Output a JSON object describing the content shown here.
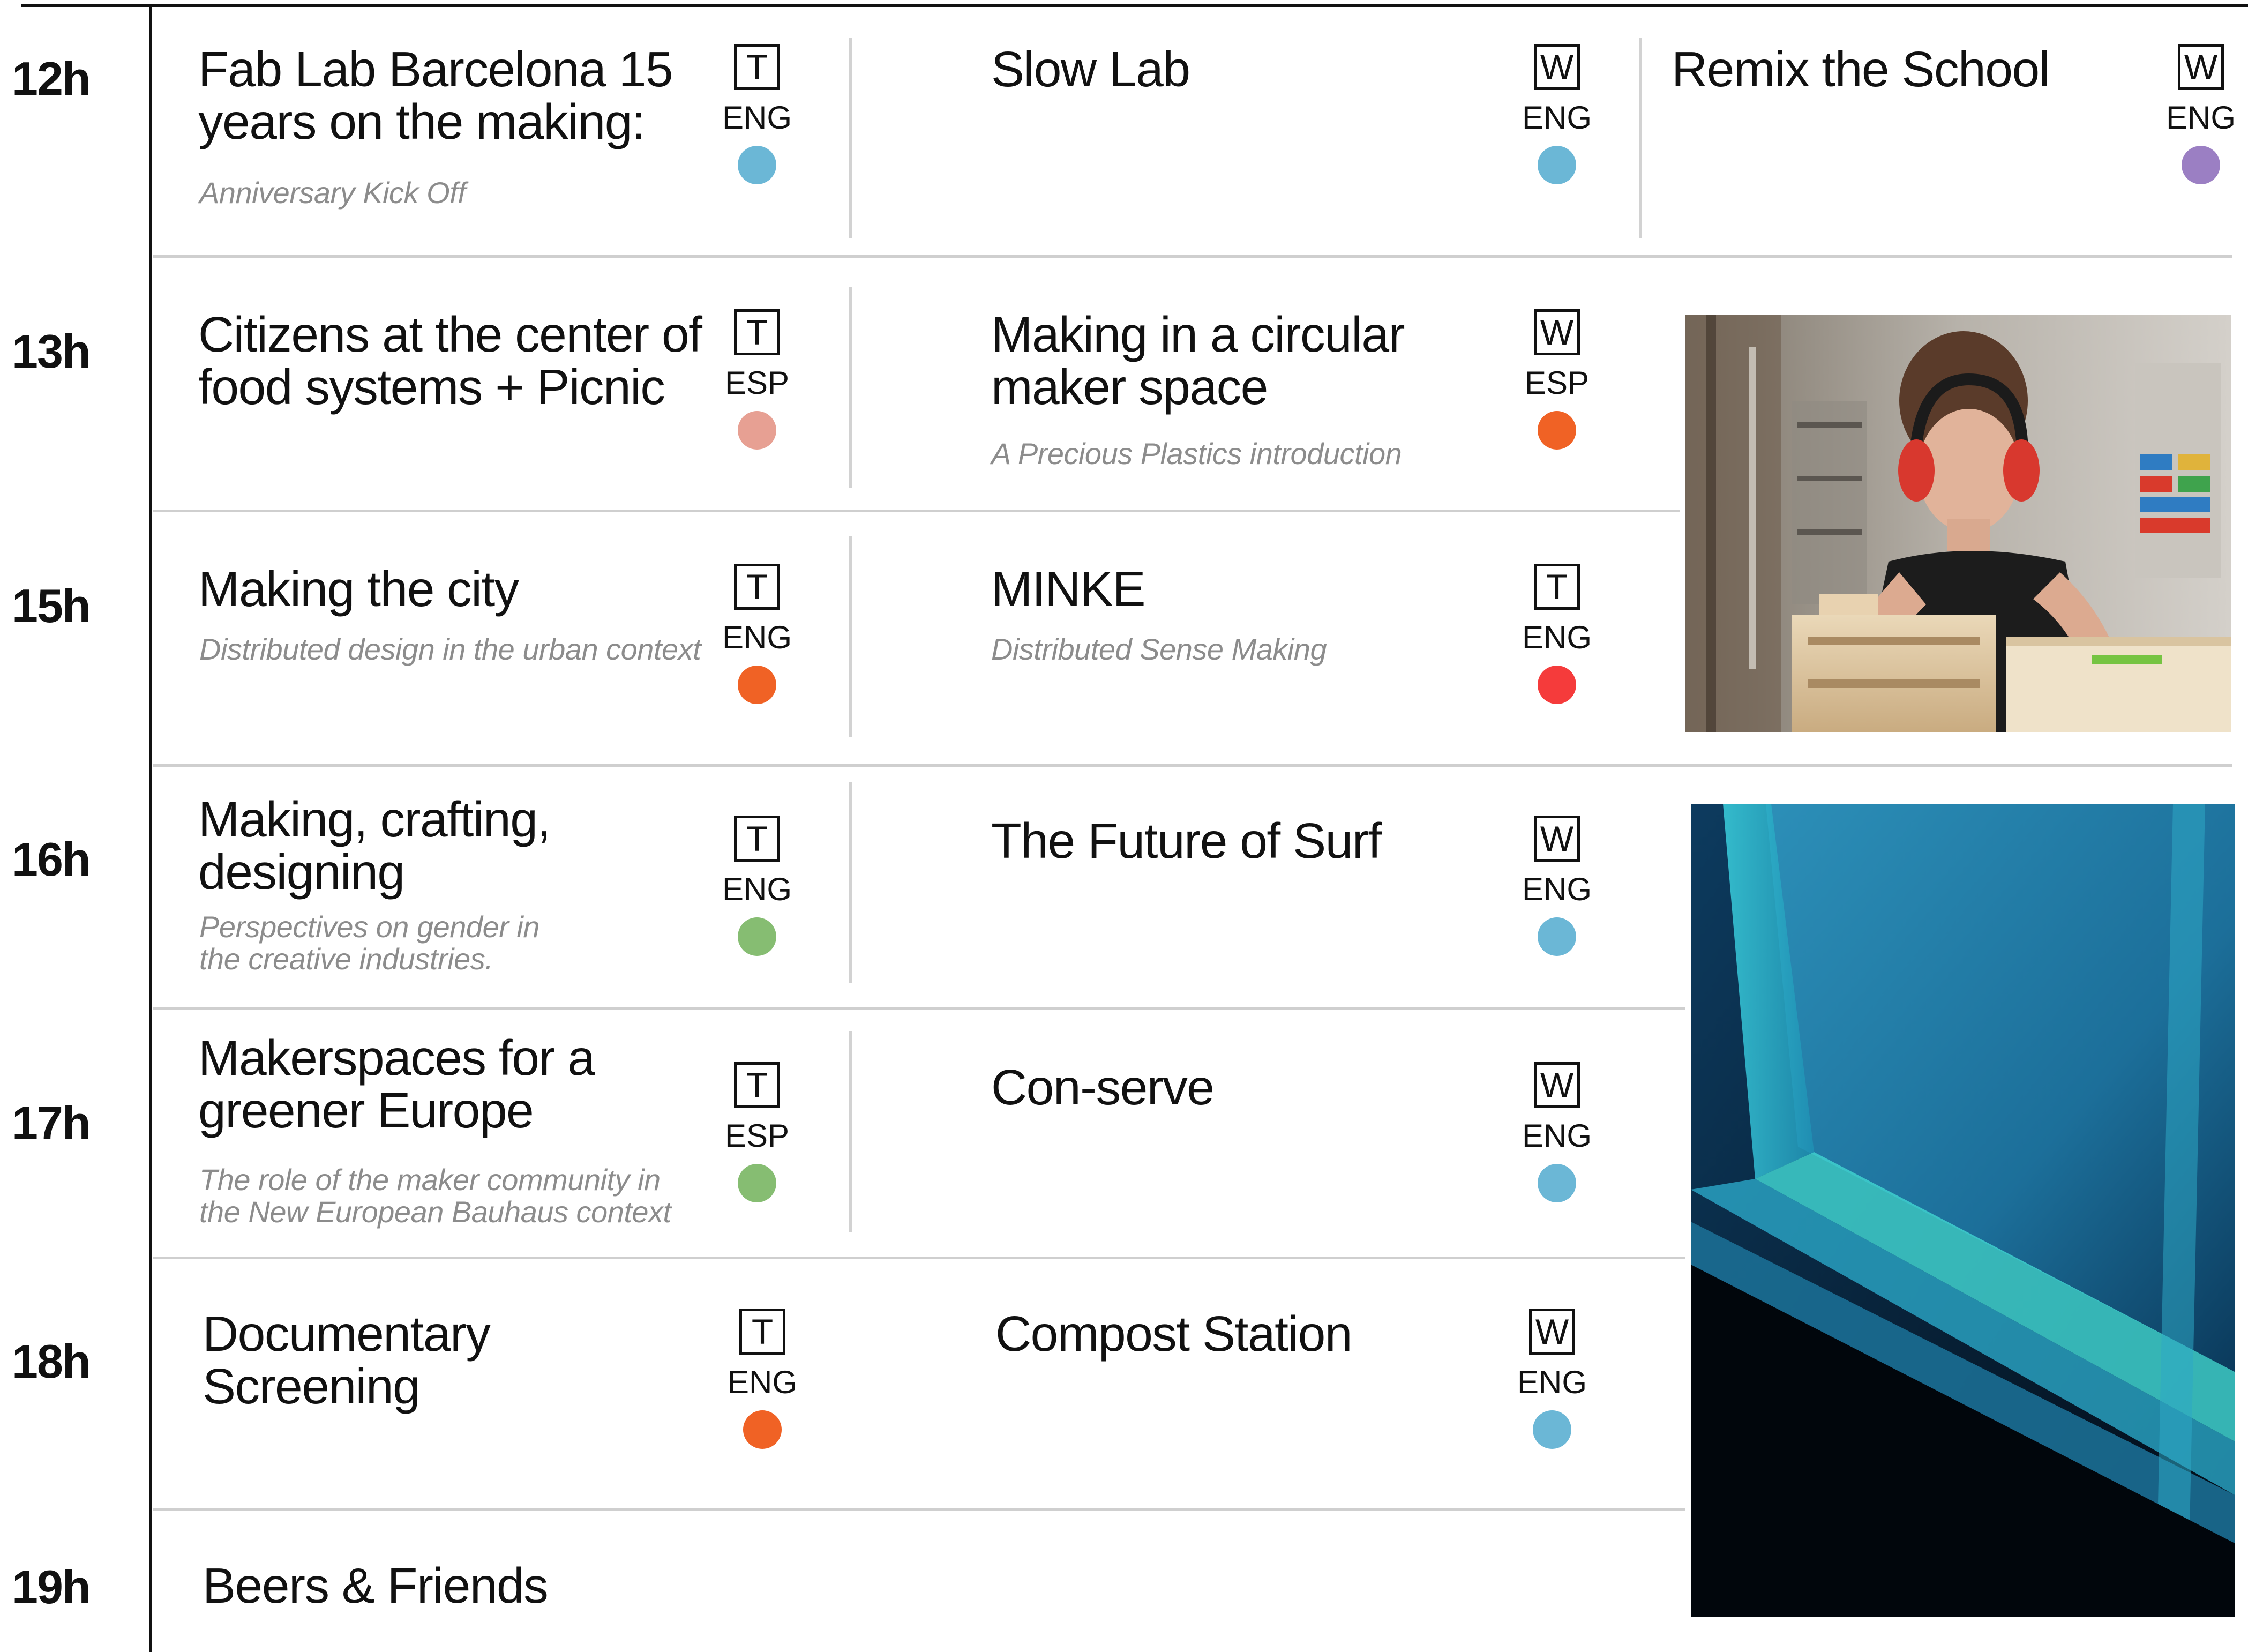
{
  "times": [
    "12h",
    "13h",
    "15h",
    "16h",
    "17h",
    "18h",
    "19h"
  ],
  "sessions": {
    "r1c1": {
      "title": "Fab Lab Barcelona 15\nyears on the making:",
      "subtitle": "Anniversary Kick Off",
      "type": "T",
      "lang": "ENG",
      "color": "#6bb7d6"
    },
    "r1c2": {
      "title": "Slow Lab",
      "type": "W",
      "lang": "ENG",
      "color": "#6bb7d6"
    },
    "r1c3": {
      "title": "Remix the School",
      "type": "W",
      "lang": "ENG",
      "color": "#9b7fc3"
    },
    "r2c1": {
      "title": "Citizens at the center of\nfood systems + Picnic",
      "type": "T",
      "lang": "ESP",
      "color": "#e7a093"
    },
    "r2c2": {
      "title": "Making in a circular\nmaker space",
      "subtitle": "A Precious Plastics introduction",
      "type": "W",
      "lang": "ESP",
      "color": "#f06225"
    },
    "r3c1": {
      "title": "Making the city",
      "subtitle": "Distributed design in the urban context",
      "type": "T",
      "lang": "ENG",
      "color": "#f06225"
    },
    "r3c2": {
      "title": "MINKE",
      "subtitle": "Distributed Sense Making",
      "type": "T",
      "lang": "ENG",
      "color": "#f53b3b"
    },
    "r4c1": {
      "title": "Making, crafting,\ndesigning",
      "subtitle": "Perspectives on gender in\nthe creative industries.",
      "type": "T",
      "lang": "ENG",
      "color": "#86bd72"
    },
    "r4c2": {
      "title": "The Future of Surf",
      "type": "W",
      "lang": "ENG",
      "color": "#6bb7d6"
    },
    "r5c1": {
      "title": "Makerspaces for a\ngreener Europe",
      "subtitle": "The role of the maker community in\nthe New European Bauhaus context",
      "type": "T",
      "lang": "ESP",
      "color": "#86bd72"
    },
    "r5c2": {
      "title": "Con-serve",
      "type": "W",
      "lang": "ENG",
      "color": "#6bb7d6"
    },
    "r6c1": {
      "title": "Documentary\nScreening",
      "type": "T",
      "lang": "ENG",
      "color": "#f06225"
    },
    "r6c2": {
      "title": "Compost Station",
      "type": "W",
      "lang": "ENG",
      "color": "#6bb7d6"
    },
    "r7c1": {
      "title": "Beers & Friends"
    }
  },
  "photos": [
    "woman-woodworking-photo",
    "blue-resin-surfboard-photo"
  ]
}
